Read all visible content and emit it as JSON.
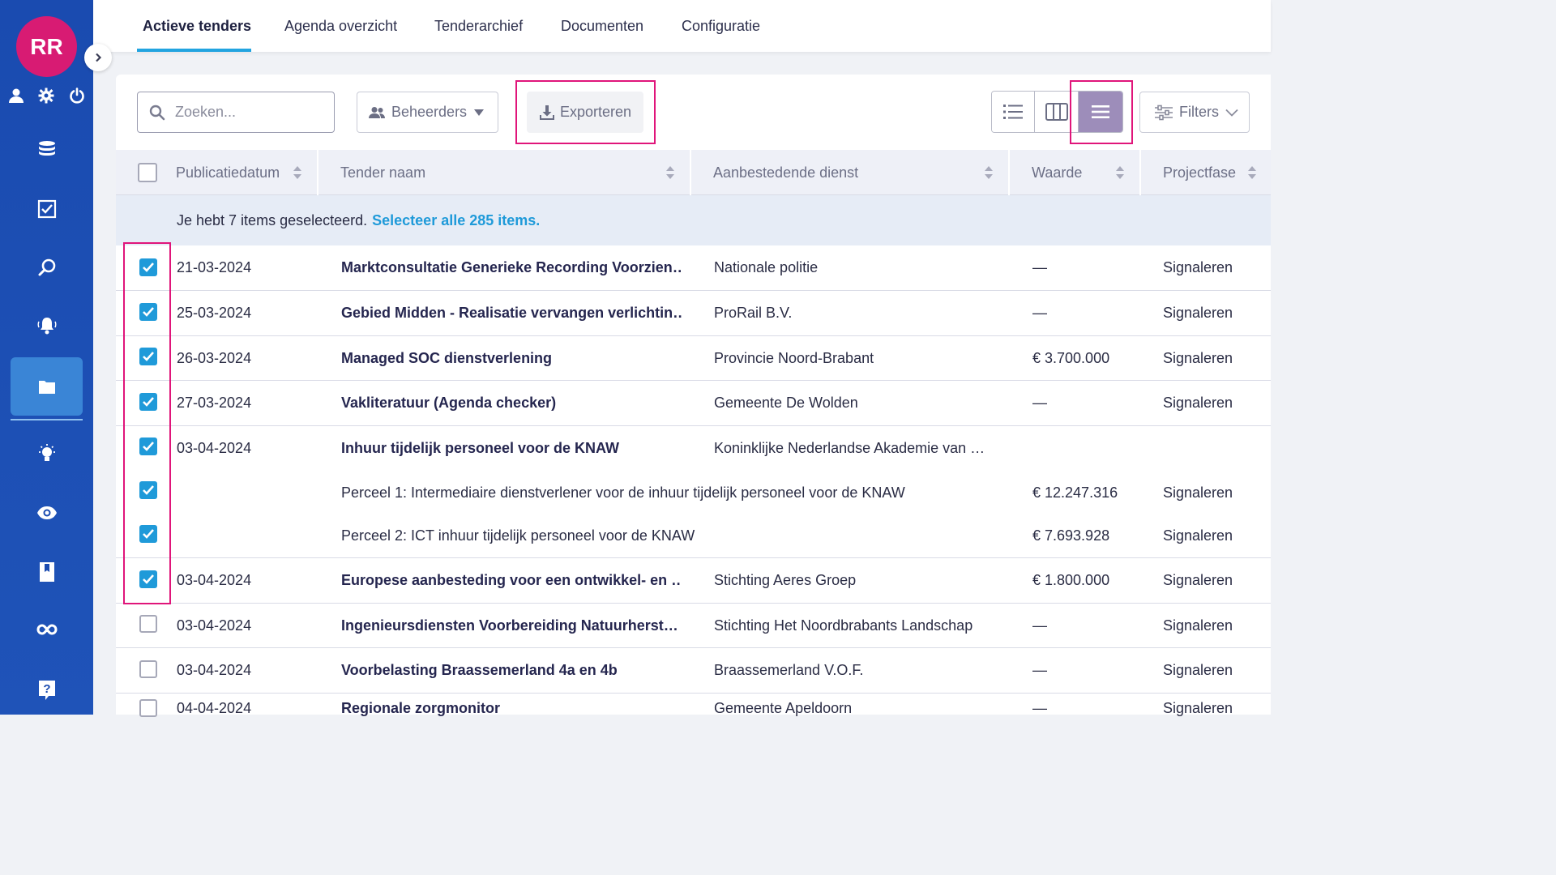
{
  "user": {
    "initials": "RR"
  },
  "colors": {
    "sidebar": "#1a4bb0",
    "avatar": "#d81b73",
    "accent": "#1f9ad9",
    "highlight": "#e0157a",
    "active_view": "#9d8dba"
  },
  "sidebar": {
    "top_icons": [
      "user-icon",
      "gear-icon",
      "power-icon"
    ],
    "items": [
      {
        "icon": "database-icon"
      },
      {
        "icon": "checkbox-icon"
      },
      {
        "icon": "search-icon"
      },
      {
        "icon": "bell-icon"
      },
      {
        "icon": "folder-icon",
        "active": true
      },
      {
        "icon": "lightbulb-icon"
      },
      {
        "icon": "eye-icon"
      },
      {
        "icon": "bookmark-icon"
      },
      {
        "icon": "infinity-icon"
      },
      {
        "icon": "help-icon"
      }
    ]
  },
  "tabs": [
    "Actieve tenders",
    "Agenda overzicht",
    "Tenderarchief",
    "Documenten",
    "Configuratie"
  ],
  "toolbar": {
    "search_placeholder": "Zoeken...",
    "beheerders_label": "Beheerders",
    "export_label": "Exporteren",
    "filters_label": "Filters"
  },
  "table": {
    "headers": [
      "Publicatiedatum",
      "Tender naam",
      "Aanbestedende dienst",
      "Waarde",
      "Projectfase"
    ],
    "selection_text": "Je hebt 7 items geselecteerd.",
    "select_all_link": "Selecteer alle 285 items.",
    "rows": [
      {
        "checked": true,
        "date": "21-03-2024",
        "name": "Marktconsultatie Generieke Recording Voorzien…",
        "dienst": "Nationale politie",
        "waarde": "—",
        "fase": "Signaleren"
      },
      {
        "checked": true,
        "date": "25-03-2024",
        "name": "Gebied Midden - Realisatie vervangen verlichtin…",
        "dienst": "ProRail B.V.",
        "waarde": "—",
        "fase": "Signaleren"
      },
      {
        "checked": true,
        "date": "26-03-2024",
        "name": "Managed SOC dienstverlening",
        "dienst": "Provincie Noord-Brabant",
        "waarde": "€ 3.700.000",
        "fase": "Signaleren"
      },
      {
        "checked": true,
        "date": "27-03-2024",
        "name": "Vakliteratuur (Agenda checker)",
        "dienst": "Gemeente De Wolden",
        "waarde": "—",
        "fase": "Signaleren"
      },
      {
        "checked": true,
        "date": "03-04-2024",
        "name": "Inhuur tijdelijk personeel voor de KNAW",
        "dienst": "Koninklijke Nederlandse Akademie van …",
        "waarde": "",
        "fase": ""
      },
      {
        "checked": true,
        "sub": true,
        "date": "",
        "name": "Perceel 1: Intermediaire dienstverlener voor de inhuur tijdelijk personeel voor de KNAW",
        "dienst": "",
        "waarde": "€ 12.247.316",
        "fase": "Signaleren"
      },
      {
        "checked": true,
        "sub": true,
        "date": "",
        "name": "Perceel 2: ICT inhuur tijdelijk personeel voor de KNAW",
        "dienst": "",
        "waarde": "€ 7.693.928",
        "fase": "Signaleren"
      },
      {
        "checked": true,
        "date": "03-04-2024",
        "name": "Europese aanbesteding voor een ontwikkel- en …",
        "dienst": "Stichting Aeres Groep",
        "waarde": "€ 1.800.000",
        "fase": "Signaleren"
      },
      {
        "checked": false,
        "date": "03-04-2024",
        "name": "Ingenieursdiensten Voorbereiding Natuurherst…",
        "dienst": "Stichting Het Noordbrabants Landschap",
        "waarde": "—",
        "fase": "Signaleren"
      },
      {
        "checked": false,
        "date": "03-04-2024",
        "name": "Voorbelasting Braassemerland 4a en 4b",
        "dienst": "Braassemerland V.O.F.",
        "waarde": "—",
        "fase": "Signaleren"
      },
      {
        "checked": false,
        "date": "04-04-2024",
        "name": "Regionale zorgmonitor",
        "dienst": "Gemeente Apeldoorn",
        "waarde": "—",
        "fase": "Signaleren"
      }
    ]
  }
}
